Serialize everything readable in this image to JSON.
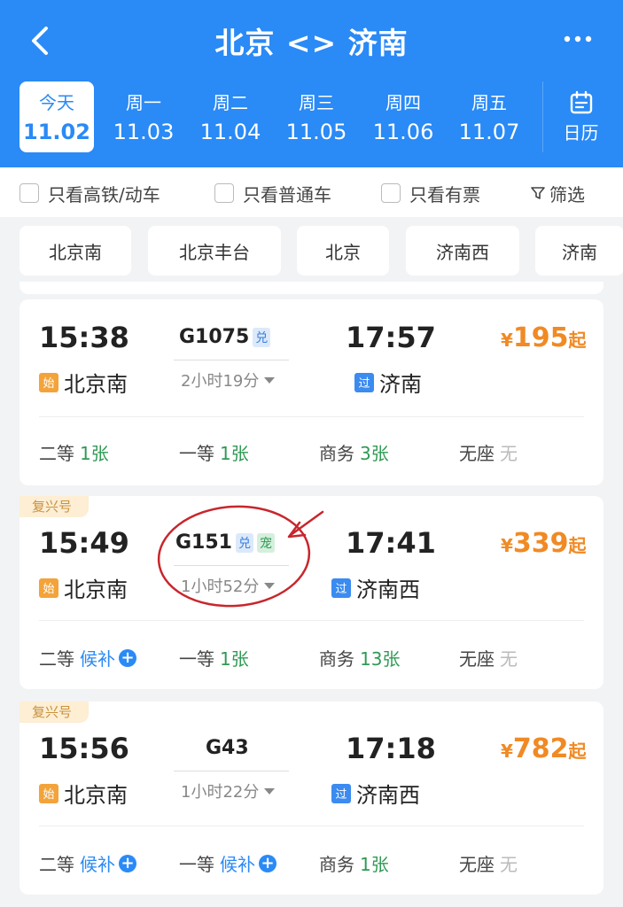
{
  "header": {
    "title": "北京 <> 济南",
    "bg_color": "#2a8af6"
  },
  "dates": [
    {
      "weekday": "今天",
      "date": "11.02",
      "active": true
    },
    {
      "weekday": "周一",
      "date": "11.03"
    },
    {
      "weekday": "周二",
      "date": "11.04"
    },
    {
      "weekday": "周三",
      "date": "11.05"
    },
    {
      "weekday": "周四",
      "date": "11.06"
    },
    {
      "weekday": "周五",
      "date": "11.07"
    }
  ],
  "calendar_label": "日历",
  "filters": {
    "high_speed": "只看高铁/动车",
    "normal": "只看普通车",
    "available": "只看有票",
    "filter_label": "筛选"
  },
  "stations": [
    "北京南",
    "北京丰台",
    "北京",
    "济南西",
    "济南"
  ],
  "trains": [
    {
      "tag": "",
      "depart_time": "15:38",
      "depart_station": "北京南",
      "depart_badge": "始",
      "train_no": "G1075",
      "chips": [
        "兑"
      ],
      "duration": "2小时19分",
      "arrive_time": "17:57",
      "arrive_station": "济南",
      "arrive_badge": "过",
      "price_symbol": "¥",
      "price": "195",
      "price_suffix": "起",
      "seats": [
        {
          "label": "二等",
          "value": "1张",
          "style": "green"
        },
        {
          "label": "一等",
          "value": "1张",
          "style": "green"
        },
        {
          "label": "商务",
          "value": "3张",
          "style": "green"
        },
        {
          "label": "无座",
          "value": "无",
          "style": "gray"
        }
      ]
    },
    {
      "tag": "复兴号",
      "depart_time": "15:49",
      "depart_station": "北京南",
      "depart_badge": "始",
      "train_no": "G151",
      "chips": [
        "兑",
        "宠"
      ],
      "duration": "1小时52分",
      "arrive_time": "17:41",
      "arrive_station": "济南西",
      "arrive_badge": "过",
      "price_symbol": "¥",
      "price": "339",
      "price_suffix": "起",
      "seats": [
        {
          "label": "二等",
          "value": "候补",
          "style": "blue",
          "plus": true
        },
        {
          "label": "一等",
          "value": "1张",
          "style": "green"
        },
        {
          "label": "商务",
          "value": "13张",
          "style": "green"
        },
        {
          "label": "无座",
          "value": "无",
          "style": "gray"
        }
      ]
    },
    {
      "tag": "复兴号",
      "depart_time": "15:56",
      "depart_station": "北京南",
      "depart_badge": "始",
      "train_no": "G43",
      "chips": [],
      "duration": "1小时22分",
      "arrive_time": "17:18",
      "arrive_station": "济南西",
      "arrive_badge": "过",
      "price_symbol": "¥",
      "price": "782",
      "price_suffix": "起",
      "seats": [
        {
          "label": "二等",
          "value": "候补",
          "style": "blue",
          "plus": true
        },
        {
          "label": "一等",
          "value": "候补",
          "style": "blue",
          "plus": true
        },
        {
          "label": "商务",
          "value": "1张",
          "style": "green"
        },
        {
          "label": "无座",
          "value": "无",
          "style": "gray"
        }
      ]
    }
  ],
  "colors": {
    "accent": "#2a8af6",
    "price": "#f08a24",
    "available": "#2f9a54",
    "annotation": "#c8262c"
  },
  "icons": {
    "back": "chevron-left-icon",
    "more": "more-dots-icon",
    "calendar": "calendar-icon",
    "filter": "funnel-icon",
    "plus": "plus-circle-icon"
  }
}
